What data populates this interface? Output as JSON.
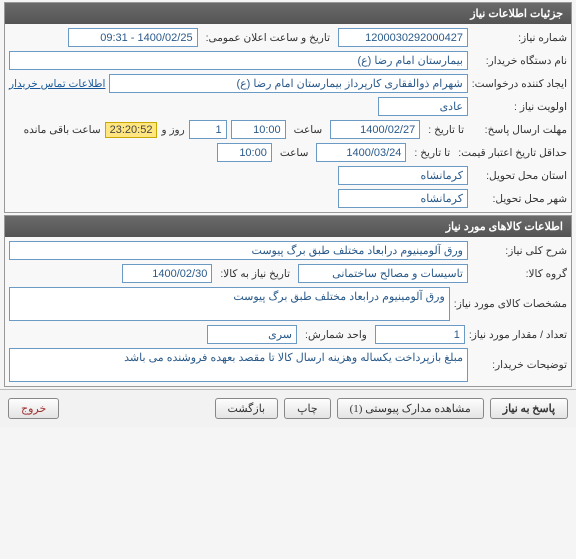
{
  "need_info": {
    "header": "جزئیات اطلاعات نیاز",
    "need_number_label": "شماره نیاز:",
    "need_number": "1200030292000427",
    "announce_label": "تاریخ و ساعت اعلان عمومی:",
    "announce_value": "1400/02/25 - 09:31",
    "buyer_label": "نام دستگاه خریدار:",
    "buyer_value": "بیمارستان امام رضا (ع)",
    "creator_label": "ایجاد کننده درخواست:",
    "creator_value": "شهرام ذوالفقاری کارپرداز بیمارستان امام رضا (ع)",
    "buyer_contact_link": "اطلاعات تماس خریدار",
    "priority_label": "اولویت نیاز :",
    "priority_value": "عادی",
    "deadline_label": "مهلت ارسال پاسخ:",
    "to_date_label": "تا تاریخ :",
    "deadline_date": "1400/02/27",
    "time_label": "ساعت",
    "deadline_time": "10:00",
    "days_value": "1",
    "days_label": "روز و",
    "timer": "23:20:52",
    "remaining_label": "ساعت باقی مانده",
    "min_valid_label": "حداقل تاریخ اعتبار قیمت:",
    "min_valid_date": "1400/03/24",
    "min_valid_time": "10:00",
    "province_label": "استان محل تحویل:",
    "province_value": "کرمانشاه",
    "city_label": "شهر محل تحویل:",
    "city_value": "کرمانشاه"
  },
  "goods_info": {
    "header": "اطلاعات کالاهای مورد نیاز",
    "title_label": "شرح کلی نیاز:",
    "title_value": "ورق آلومینیوم درابعاد مختلف طبق برگ پیوست",
    "group_label": "گروه کالا:",
    "group_value": "تاسیسات و مصالح ساختمانی",
    "need_date_label": "تاریخ نیاز به کالا:",
    "need_date_value": "1400/02/30",
    "specs_label": "مشخصات کالای مورد نیاز:",
    "specs_value": "ورق آلومینیوم درابعاد مختلف طبق برگ پیوست",
    "qty_label": "تعداد / مقدار مورد نیاز:",
    "qty_value": "1",
    "unit_label": "واحد شمارش:",
    "unit_value": "سری",
    "notes_label": "توضیحات خریدار:",
    "notes_value": "مبلغ بازپرداخت یکساله وهزینه ارسال کالا تا مقصد بعهده فروشنده می باشد"
  },
  "buttons": {
    "respond": "پاسخ به نیاز",
    "view_attach": "مشاهده مدارک پیوستی (1)",
    "print": "چاپ",
    "back": "بازگشت",
    "exit": "خروج"
  }
}
